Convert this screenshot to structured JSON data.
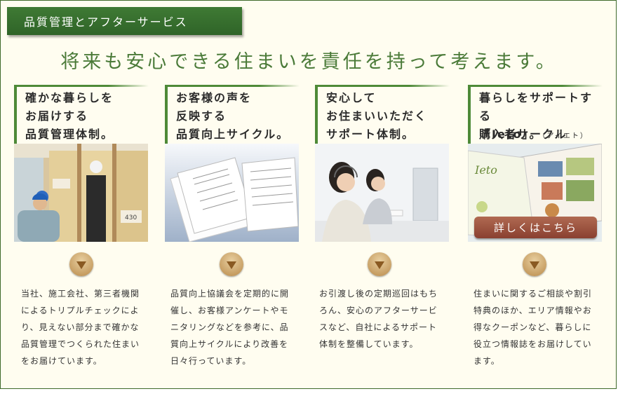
{
  "header": {
    "tag": "品質管理とアフターサービス"
  },
  "tagline": "将来も安心できる住まいを責任を持って考えます。",
  "cards": [
    {
      "title": "確かな暮らしを\nお届けする\n品質管理体制。",
      "description": "当社、施工会社、第三者機関によるトリプルチェックにより、見えない部分まで確かな品質管理でつくられた住まいをお届けています。"
    },
    {
      "title": "お客様の声を\n反映する\n品質向上サイクル。",
      "description": "品質向上協議会を定期的に開催し、お客様アンケートやモニタリングなどを参考に、品質向上サイクルにより改善を日々行っています。"
    },
    {
      "title": "安心して\nお住まいいただく\nサポート体制。",
      "description": "お引渡し後の定期巡回はもちろん、安心のアフターサービスなど、自社によるサポート体制を整備しています。"
    },
    {
      "title": "暮らしをサポートする\n購入者サークル",
      "title_line3": "「Ieto」。",
      "title_note": "（アイエト）",
      "description": "住まいに関するご相談や割引特典のほか、エリア情報やお得なクーポンなど、暮らしに役立つ情報誌をお届けしています。"
    }
  ],
  "more_button": "詳しくはこちら",
  "magazine_logo": "Ieto",
  "colors": {
    "green": "#3f7a34",
    "accent_brown": "#b98a4a",
    "button_red": "#9a4c38",
    "background": "#fffdf0"
  }
}
